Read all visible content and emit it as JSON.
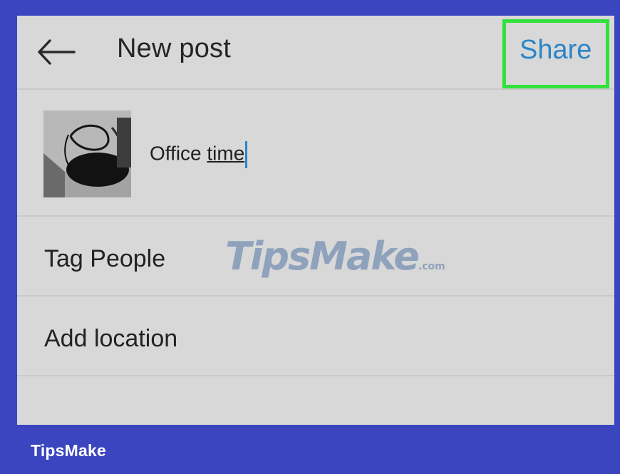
{
  "header": {
    "title": "New post",
    "share_label": "Share"
  },
  "post": {
    "caption_prefix": "Office",
    "caption_underlined": "time"
  },
  "options": [
    {
      "label": "Tag People"
    },
    {
      "label": "Add location"
    }
  ],
  "watermark": {
    "text": "TipsMake",
    "suffix": ".com"
  },
  "footer": {
    "brand": "TipsMake"
  },
  "colors": {
    "frame": "#3a45bf",
    "background": "#d8d8d8",
    "share_text": "#2b84c8",
    "highlight": "#32e23c"
  },
  "icons": {
    "back": "arrow-left-icon"
  }
}
